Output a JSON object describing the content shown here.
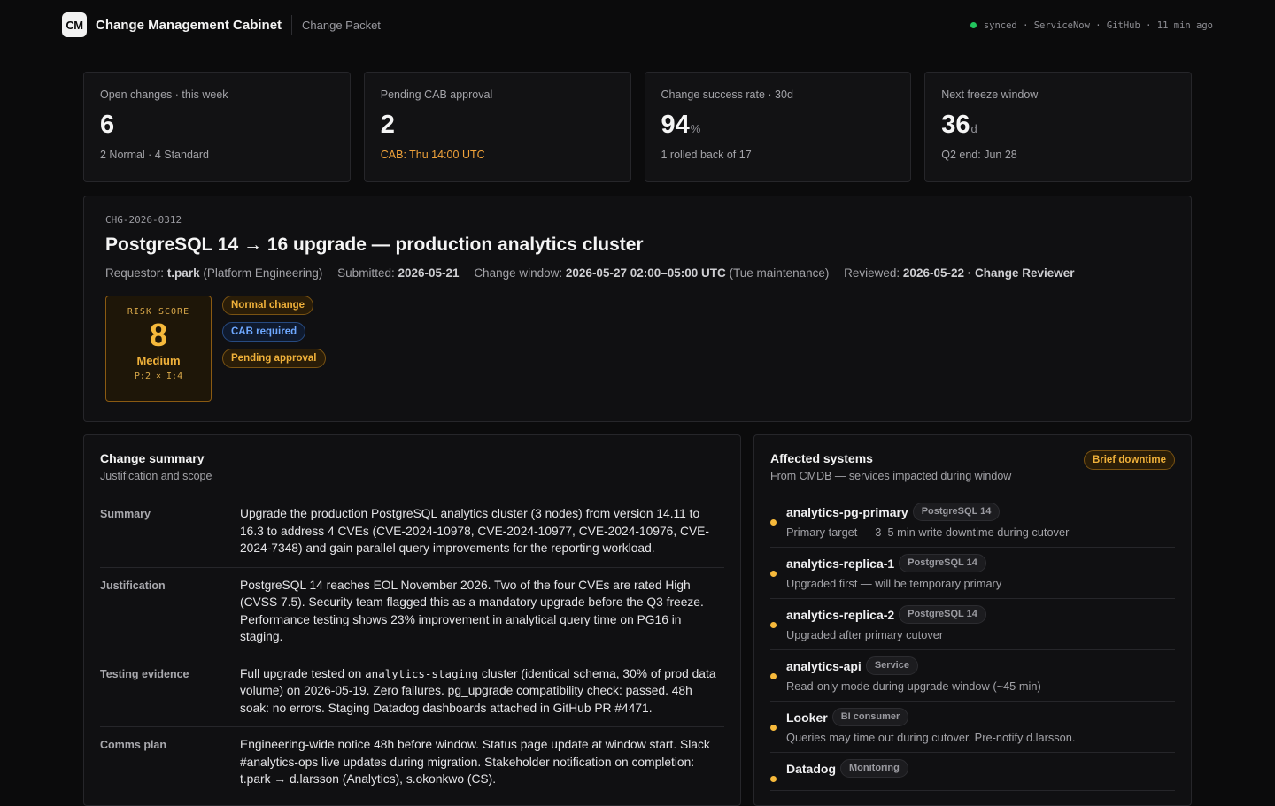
{
  "header": {
    "logo": "CM",
    "app_title": "Change Management Cabinet",
    "breadcrumb": "Change Packet",
    "sync_text": "synced · ServiceNow · GitHub · 11 min ago"
  },
  "stats": [
    {
      "label": "Open changes · this week",
      "value": "6",
      "unit": "",
      "sub": "2 Normal · 4 Standard"
    },
    {
      "label": "Pending CAB approval",
      "value": "2",
      "unit": "",
      "sub": "CAB: Thu 14:00 UTC"
    },
    {
      "label": "Change success rate · 30d",
      "value": "94",
      "unit": "%",
      "sub": "1 rolled back of 17"
    },
    {
      "label": "Next freeze window",
      "value": "36",
      "unit": "d",
      "sub": "Q2 end: Jun 28"
    }
  ],
  "packet": {
    "id": "CHG-2026-0312",
    "title": "PostgreSQL 14 → 16 upgrade — production analytics cluster",
    "requestor_label": "Requestor:",
    "requestor": "t.park",
    "requestor_team": "(Platform Engineering)",
    "submitted_label": "Submitted:",
    "submitted": "2026-05-21",
    "window_label": "Change window:",
    "window": "2026-05-27 02:00–05:00 UTC",
    "window_note": "(Tue maintenance)",
    "reviewed_label": "Reviewed:",
    "reviewed": "2026-05-22 · Change Reviewer",
    "risk": {
      "label": "RISK SCORE",
      "score": "8",
      "level": "Medium",
      "formula": "P:2 × I:4"
    },
    "badges": [
      "Normal change",
      "CAB required",
      "Pending approval"
    ]
  },
  "summary": {
    "title": "Change summary",
    "subtitle": "Justification and scope",
    "rows": [
      {
        "key": "Summary",
        "value": "Upgrade the production PostgreSQL analytics cluster (3 nodes) from version 14.11 to 16.3 to address 4 CVEs (CVE-2024-10978, CVE-2024-10977, CVE-2024-10976, CVE-2024-7348) and gain parallel query improvements for the reporting workload."
      },
      {
        "key": "Justification",
        "value": "PostgreSQL 14 reaches EOL November 2026. Two of the four CVEs are rated High (CVSS 7.5). Security team flagged this as a mandatory upgrade before the Q3 freeze. Performance testing shows 23% improvement in analytical query time on PG16 in staging."
      },
      {
        "key": "Testing evidence",
        "value_pre": "Full upgrade tested on ",
        "value_code": "analytics-staging",
        "value_post": " cluster (identical schema, 30% of prod data volume) on 2026-05-19. Zero failures. pg_upgrade compatibility check: passed. 48h soak: no errors. Staging Datadog dashboards attached in GitHub PR #4471."
      },
      {
        "key": "Comms plan",
        "value": "Engineering-wide notice 48h before window. Status page update at window start. Slack #analytics-ops live updates during migration. Stakeholder notification on completion: t.park → d.larsson (Analytics), s.okonkwo (CS)."
      }
    ]
  },
  "systems": {
    "title": "Affected systems",
    "subtitle": "From CMDB — services impacted during window",
    "badge": "Brief downtime",
    "items": [
      {
        "name": "analytics-pg-primary",
        "tag": "PostgreSQL 14",
        "desc": "Primary target — 3–5 min write downtime during cutover"
      },
      {
        "name": "analytics-replica-1",
        "tag": "PostgreSQL 14",
        "desc": "Upgraded first — will be temporary primary"
      },
      {
        "name": "analytics-replica-2",
        "tag": "PostgreSQL 14",
        "desc": "Upgraded after primary cutover"
      },
      {
        "name": "analytics-api",
        "tag": "Service",
        "desc": "Read-only mode during upgrade window (~45 min)"
      },
      {
        "name": "Looker",
        "tag": "BI consumer",
        "desc": "Queries may time out during cutover. Pre-notify d.larsson."
      },
      {
        "name": "Datadog",
        "tag": "Monitoring",
        "desc": ""
      }
    ]
  },
  "colors": {
    "accent_amber": "#f6b93b",
    "accent_blue": "#6ea8ff",
    "status_green": "#22c55e",
    "background": "#0b0b0c"
  }
}
